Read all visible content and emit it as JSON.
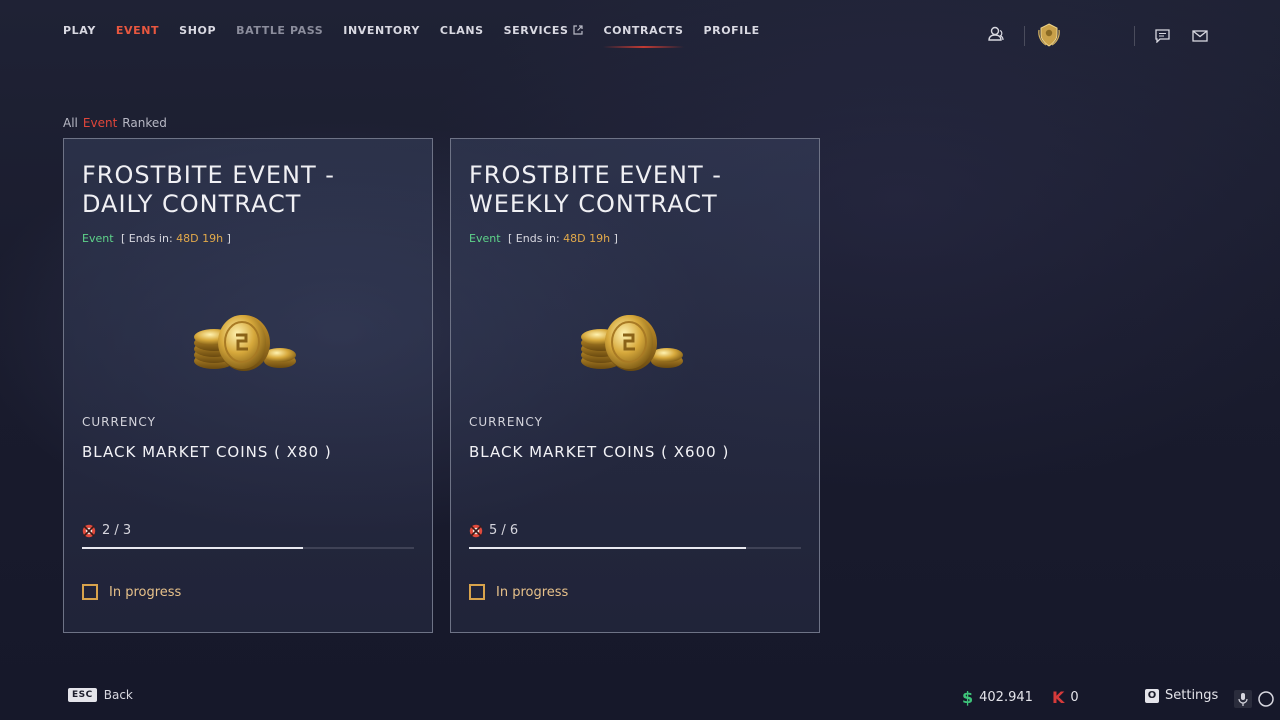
{
  "nav": {
    "items": [
      {
        "label": "PLAY"
      },
      {
        "label": "EVENT"
      },
      {
        "label": "SHOP"
      },
      {
        "label": "BATTLE PASS"
      },
      {
        "label": "INVENTORY"
      },
      {
        "label": "CLANS"
      },
      {
        "label": "SERVICES"
      },
      {
        "label": "CONTRACTS"
      },
      {
        "label": "PROFILE"
      }
    ]
  },
  "filter": {
    "all": "All",
    "event": "Event",
    "ranked": "Ranked"
  },
  "cards": [
    {
      "title": "FROSTBITE EVENT - DAILY CONTRACT",
      "tag": "Event",
      "ends_prefix": "[ Ends in:",
      "ends_time": "48D 19h",
      "ends_suffix": "]",
      "category": "CURRENCY",
      "reward": "BLACK MARKET COINS ( X80 )",
      "progress_text": "2 / 3",
      "progress_fraction": 0.667,
      "status": "In progress"
    },
    {
      "title": "FROSTBITE EVENT - WEEKLY CONTRACT",
      "tag": "Event",
      "ends_prefix": "[ Ends in:",
      "ends_time": "48D 19h",
      "ends_suffix": "]",
      "category": "CURRENCY",
      "reward": "BLACK MARKET COINS ( X600 )",
      "progress_text": "5 / 6",
      "progress_fraction": 0.833,
      "status": "In progress"
    }
  ],
  "footer": {
    "back_key": "ESC",
    "back_label": "Back",
    "money_symbol": "$",
    "money_value": "402.941",
    "k_symbol": "K",
    "k_value": "0",
    "settings_key": "O",
    "settings_label": "Settings"
  },
  "colors": {
    "accent_red": "#e0463a",
    "event_green": "#5ed38a",
    "time_orange": "#e2a94a",
    "status_gold": "#d8a34c"
  },
  "icons": {
    "friends": "friends-icon",
    "rank": "rank-badge-icon",
    "chat": "chat-icon",
    "mail": "mail-icon",
    "external": "external-link-icon",
    "coins": "coins-icon",
    "progress": "progress-target-icon",
    "mic": "mic-icon",
    "ring": "ring-icon"
  }
}
